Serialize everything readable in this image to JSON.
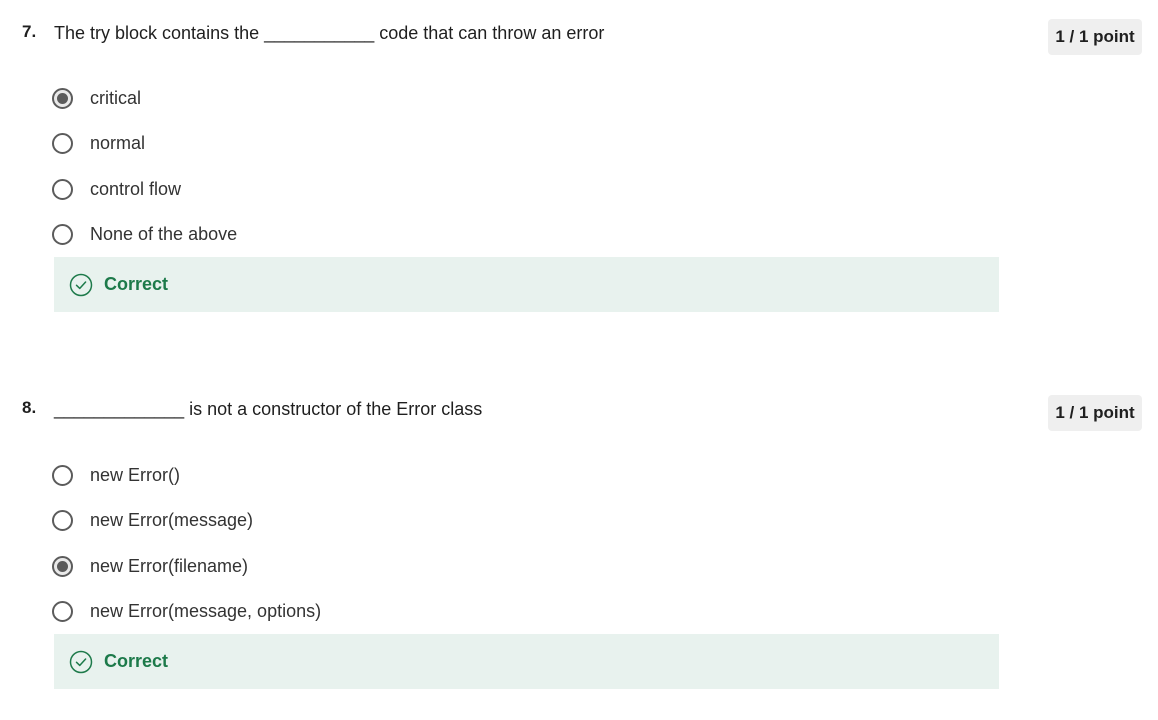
{
  "questions": [
    {
      "number": "7.",
      "text": "The try block contains the ___________ code that can throw an error",
      "points": "1 / 1 point",
      "options": [
        {
          "label": "critical",
          "selected": true
        },
        {
          "label": "normal",
          "selected": false
        },
        {
          "label": "control flow",
          "selected": false
        },
        {
          "label": "None of the above",
          "selected": false
        }
      ],
      "feedback": "Correct"
    },
    {
      "number": "8.",
      "text": "_____________ is not a constructor of the Error class",
      "points": "1 / 1 point",
      "options": [
        {
          "label": "new Error()",
          "selected": false
        },
        {
          "label": "new Error(message)",
          "selected": false
        },
        {
          "label": "new Error(filename)",
          "selected": true
        },
        {
          "label": "new Error(message, options)",
          "selected": false
        }
      ],
      "feedback": "Correct"
    }
  ],
  "colors": {
    "feedback_bg": "#e8f2ee",
    "feedback_text": "#1d7a4a",
    "badge_bg": "#efefef",
    "radio": "#5b5b5b"
  },
  "icons": {
    "feedback_icon": "check-circle-icon"
  }
}
